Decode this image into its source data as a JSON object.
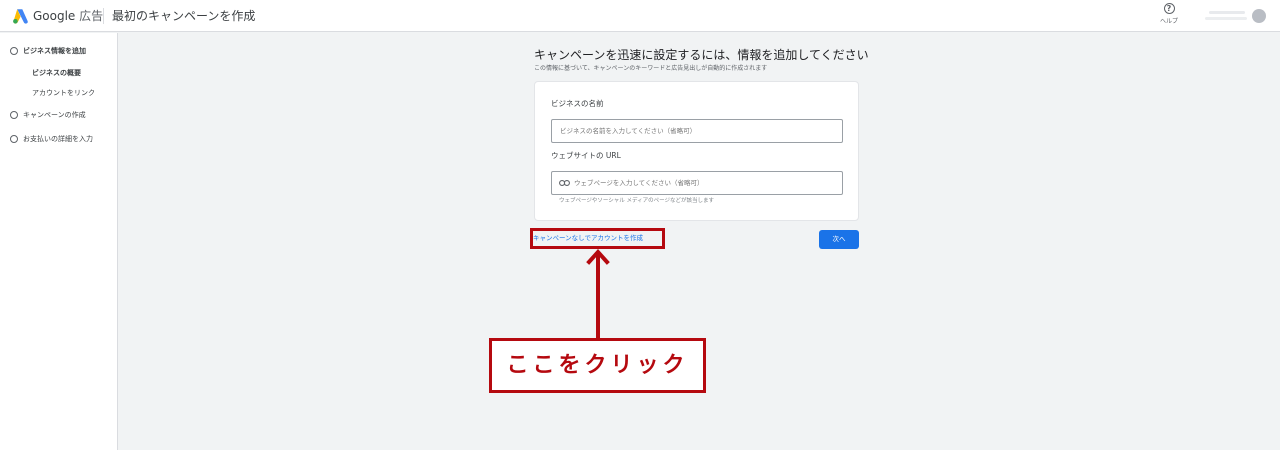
{
  "header": {
    "brand_google": "Google",
    "brand_product": "広告",
    "page_title": "最初のキャンペーンを作成",
    "help_label": "ヘルプ"
  },
  "sidebar": {
    "steps": [
      {
        "label": "ビジネス情報を追加"
      },
      {
        "label": "キャンペーンの作成"
      },
      {
        "label": "お支払いの詳細を入力"
      }
    ],
    "substeps": [
      {
        "label": "ビジネスの概要"
      },
      {
        "label": "アカウントをリンク"
      }
    ]
  },
  "main": {
    "headline": "キャンペーンを迅速に設定するには、情報を追加してください",
    "subheadline": "この情報に基づいて、キャンペーンのキーワードと広告見出しが自動的に作成されます",
    "business_name": {
      "label": "ビジネスの名前",
      "placeholder": "ビジネスの名前を入力してください（省略可）",
      "value": ""
    },
    "website": {
      "label": "ウェブサイトの URL",
      "placeholder": "ウェブページを入力してください（省略可）",
      "value": "",
      "hint": "ウェブページやソーシャル メディアのページなどが該当します",
      "icon": "link-icon"
    },
    "no_campaign_link": "キャンペーンなしでアカウントを作成",
    "next_button": "次へ"
  },
  "annotation": {
    "callout_text": "ここをクリック",
    "color": "#b5090f"
  },
  "colors": {
    "primary": "#1a73e8",
    "background": "#f1f3f4",
    "annotation": "#b5090f"
  }
}
